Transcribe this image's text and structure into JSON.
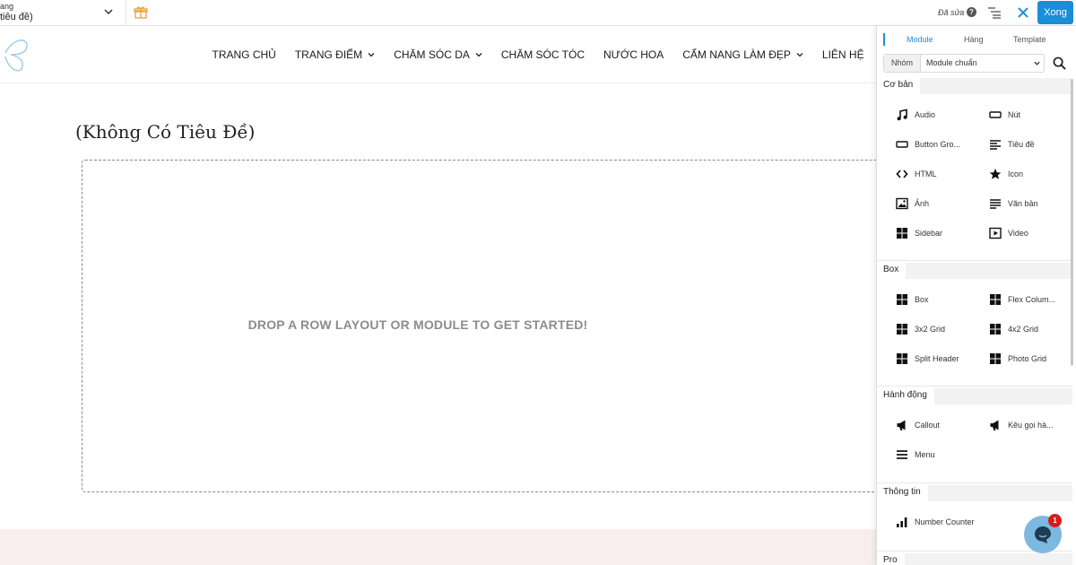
{
  "topbar": {
    "page_label": "ang",
    "page_title": "tiêu đề)",
    "edited_status": "Đã sửa",
    "help_glyph": "?",
    "done_label": "Xong"
  },
  "nav": {
    "items": [
      {
        "label": "TRANG CHỦ",
        "has_dropdown": false
      },
      {
        "label": "TRANG ĐIỂM",
        "has_dropdown": true
      },
      {
        "label": "CHĂM SÓC DA",
        "has_dropdown": true
      },
      {
        "label": "CHĂM SÓC TÓC",
        "has_dropdown": false
      },
      {
        "label": "NƯỚC HOA",
        "has_dropdown": false
      },
      {
        "label": "CẨM NANG LÀM ĐẸP",
        "has_dropdown": true
      },
      {
        "label": "LIÊN HỆ",
        "has_dropdown": false
      }
    ]
  },
  "content": {
    "title": "(Không Có Tiêu Đề)",
    "drop_text": "DROP A ROW LAYOUT OR MODULE TO GET STARTED!"
  },
  "panel": {
    "tabs": [
      {
        "label": "Module",
        "active": true
      },
      {
        "label": "Hàng",
        "active": false
      },
      {
        "label": "Template",
        "active": false
      }
    ],
    "filter_label": "Nhóm",
    "filter_value": "Module chuẩn",
    "sections": [
      {
        "label": "Cơ bản",
        "modules": [
          {
            "label": "Audio",
            "icon": "music-note-icon"
          },
          {
            "label": "Nút",
            "icon": "button-icon"
          },
          {
            "label": "Button Gro...",
            "icon": "button-group-icon"
          },
          {
            "label": "Tiêu đề",
            "icon": "heading-icon"
          },
          {
            "label": "HTML",
            "icon": "code-icon"
          },
          {
            "label": "Icon",
            "icon": "star-icon"
          },
          {
            "label": "Ảnh",
            "icon": "image-icon"
          },
          {
            "label": "Văn bản",
            "icon": "text-icon"
          },
          {
            "label": "Sidebar",
            "icon": "layout-grid-icon"
          },
          {
            "label": "Video",
            "icon": "video-icon"
          }
        ]
      },
      {
        "label": "Box",
        "modules": [
          {
            "label": "Box",
            "icon": "layout-grid-icon"
          },
          {
            "label": "Flex Colum...",
            "icon": "layout-grid-icon"
          },
          {
            "label": "3x2 Grid",
            "icon": "layout-grid-icon"
          },
          {
            "label": "4x2 Grid",
            "icon": "layout-grid-icon"
          },
          {
            "label": "Split Header",
            "icon": "layout-grid-icon"
          },
          {
            "label": "Photo Grid",
            "icon": "layout-grid-icon"
          }
        ]
      },
      {
        "label": "Hành động",
        "modules": [
          {
            "label": "Callout",
            "icon": "megaphone-icon"
          },
          {
            "label": "Kêu gọi hà...",
            "icon": "megaphone-icon"
          },
          {
            "label": "Menu",
            "icon": "menu-icon"
          }
        ]
      },
      {
        "label": "Thông tin",
        "modules": [
          {
            "label": "Number Counter",
            "icon": "bar-chart-icon"
          }
        ]
      },
      {
        "label": "Pro",
        "modules": []
      }
    ]
  },
  "chat": {
    "badge_count": "1"
  },
  "colors": {
    "accent": "#1a8fd6",
    "footer_tint": "#f8eeef",
    "badge": "#d81b1b",
    "chat_bubble": "#7db8e0"
  }
}
